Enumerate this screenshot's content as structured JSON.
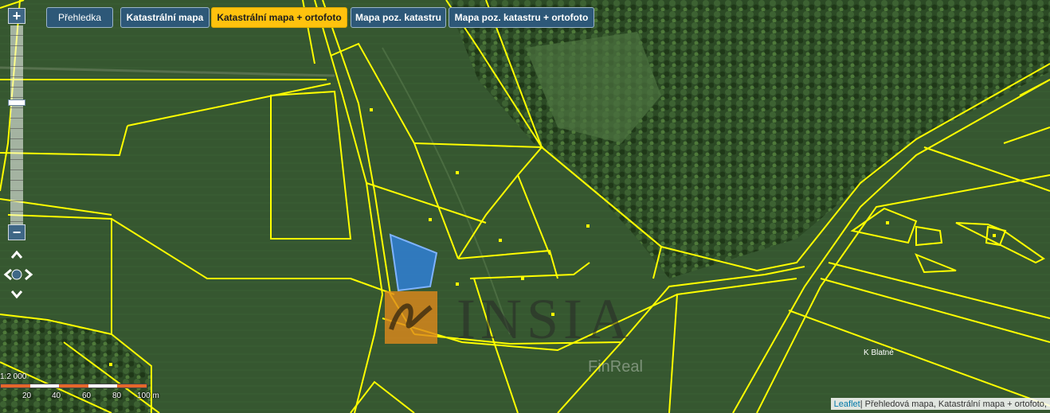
{
  "tabs": [
    {
      "label": "Přehledka",
      "active": false
    },
    {
      "label": "Katastrální mapa",
      "active": false
    },
    {
      "label": "Katastrální mapa + ortofoto",
      "active": true
    },
    {
      "label": "Mapa poz. katastru",
      "active": false
    },
    {
      "label": "Mapa poz. katastru + ortofoto",
      "active": false
    }
  ],
  "zoom": {
    "in_label": "+",
    "out_label": "−",
    "level_fraction": 0.37
  },
  "pan_icons": [
    "pan-up-icon",
    "pan-left-icon",
    "pan-right-icon",
    "pan-down-icon"
  ],
  "scale": {
    "ratio": "1:2 000",
    "ticks": [
      "20",
      "40",
      "60",
      "80",
      "100 m"
    ]
  },
  "attribution": {
    "link": "Leaflet",
    "text": " | Přehledová mapa, Katastrální mapa + ortofoto,"
  },
  "watermark": {
    "brand": "INSIA",
    "sub": "FinReal"
  },
  "place_label": "K Blatné",
  "colors": {
    "parcel_line": "#ffff00",
    "highlight_fill": "#2f7fd6",
    "tab_bg": "#2d5878",
    "tab_active_bg": "#ffc20e",
    "field": "#34532d",
    "forest": "#27401f",
    "logo_orange": "#e08a1c"
  }
}
